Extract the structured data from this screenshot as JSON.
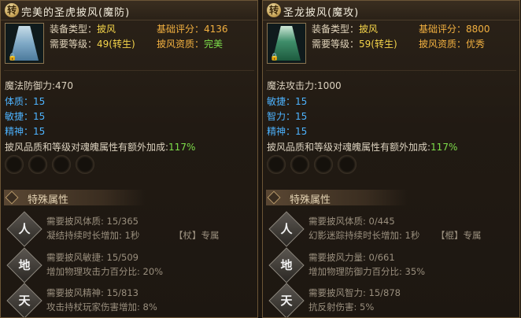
{
  "left": {
    "badge": "转",
    "title": "完美的圣虎披风(魔防)",
    "row1_label": "装备类型：",
    "row1_value": "披风",
    "row1b_label": "基础评分：",
    "row1b_value": "4136",
    "row2_label": "需要等级：",
    "row2_value": "49(转生)",
    "row2b_label": "披风资质：",
    "row2b_value": "完美",
    "main_stat": "魔法防御力:470",
    "stats": [
      {
        "label": "体质：",
        "value": "15"
      },
      {
        "label": "敏捷：",
        "value": "15"
      },
      {
        "label": "精神：",
        "value": "15"
      }
    ],
    "bonus_text": "披风品质和等级对魂魄属性有额外加成:",
    "bonus_value": "117%",
    "special_title": "特殊属性",
    "skills": [
      {
        "icon": "人",
        "req": "需要披风体质: 15/365",
        "desc": "凝结持续时长增加: 1秒",
        "tag": "【杖】专属"
      },
      {
        "icon": "地",
        "req": "需要披风敏捷: 15/509",
        "desc": "增加物理攻击力百分比: 20%",
        "tag": ""
      },
      {
        "icon": "天",
        "req": "需要披风精神: 15/813",
        "desc": "攻击持杖玩家伤害增加: 8%",
        "tag": ""
      }
    ]
  },
  "right": {
    "badge": "转",
    "title": "圣龙披风(魔攻)",
    "row1_label": "装备类型：",
    "row1_value": "披风",
    "row1b_label": "基础评分：",
    "row1b_value": "8800",
    "row2_label": "需要等级：",
    "row2_value": "59(转生)",
    "row2b_label": "披风资质：",
    "row2b_value": "优秀",
    "main_stat": "魔法攻击力:1000",
    "stats": [
      {
        "label": "敏捷：",
        "value": "15"
      },
      {
        "label": "智力：",
        "value": "15"
      },
      {
        "label": "精神：",
        "value": "15"
      }
    ],
    "bonus_text": "披风品质和等级对魂魄属性有额外加成:",
    "bonus_value": "117%",
    "special_title": "特殊属性",
    "skills": [
      {
        "icon": "人",
        "req": "需要披风体质: 0/445",
        "desc": "幻影迷踪持续时长增加: 1秒",
        "tag": "【棍】专属"
      },
      {
        "icon": "地",
        "req": "需要披风力量: 0/661",
        "desc": "增加物理防御力百分比: 35%",
        "tag": ""
      },
      {
        "icon": "天",
        "req": "需要披风智力: 15/878",
        "desc": "抗反射伤害: 5%",
        "tag": ""
      }
    ]
  }
}
